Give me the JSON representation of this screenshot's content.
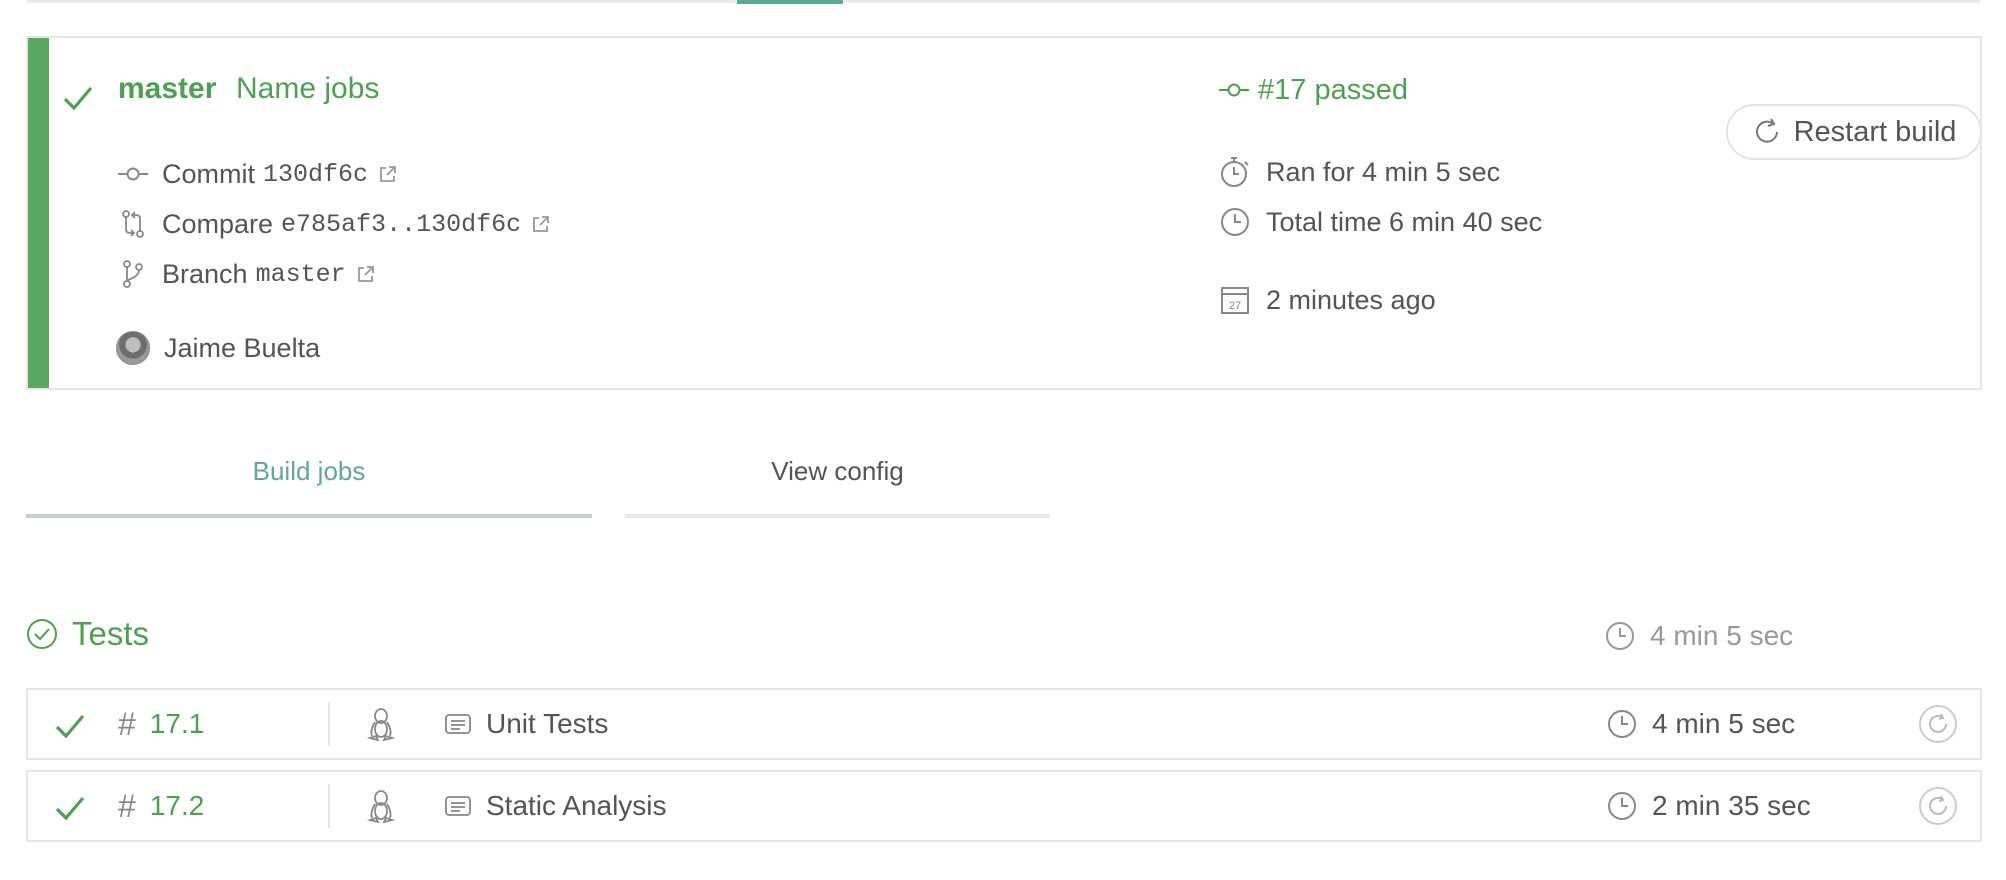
{
  "build": {
    "branch": "master",
    "message": "Name jobs",
    "commit_label": "Commit",
    "commit_sha": "130df6c",
    "compare_label": "Compare",
    "compare_range": "e785af3..130df6c",
    "branch_label": "Branch",
    "branch_name": "master",
    "author": "Jaime Buelta",
    "status_text": "#17 passed",
    "ran_for": "Ran for 4 min 5 sec",
    "total_time": "Total time 6 min 40 sec",
    "finished": "2 minutes ago",
    "calendar_day": "27",
    "restart_label": "Restart build",
    "status_color": "#4ea053"
  },
  "tabs": [
    {
      "label": "Build jobs",
      "active": true
    },
    {
      "label": "View config",
      "active": false
    }
  ],
  "stage": {
    "name": "Tests",
    "duration": "4 min 5 sec"
  },
  "jobs": [
    {
      "number": "17.1",
      "os": "linux",
      "name": "Unit Tests",
      "duration": "4 min 5 sec"
    },
    {
      "number": "17.2",
      "os": "linux",
      "name": "Static Analysis",
      "duration": "2 min 35 sec"
    }
  ]
}
